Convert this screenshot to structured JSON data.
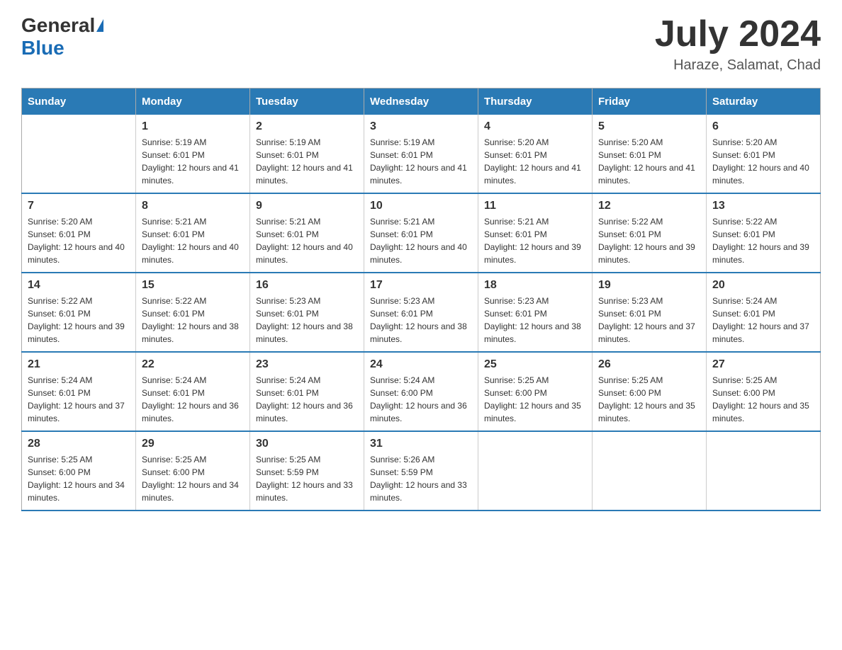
{
  "header": {
    "logo_general": "General",
    "logo_blue": "Blue",
    "month_year": "July 2024",
    "location": "Haraze, Salamat, Chad"
  },
  "days_of_week": [
    "Sunday",
    "Monday",
    "Tuesday",
    "Wednesday",
    "Thursday",
    "Friday",
    "Saturday"
  ],
  "weeks": [
    [
      {
        "day": "",
        "sunrise": "",
        "sunset": "",
        "daylight": ""
      },
      {
        "day": "1",
        "sunrise": "Sunrise: 5:19 AM",
        "sunset": "Sunset: 6:01 PM",
        "daylight": "Daylight: 12 hours and 41 minutes."
      },
      {
        "day": "2",
        "sunrise": "Sunrise: 5:19 AM",
        "sunset": "Sunset: 6:01 PM",
        "daylight": "Daylight: 12 hours and 41 minutes."
      },
      {
        "day": "3",
        "sunrise": "Sunrise: 5:19 AM",
        "sunset": "Sunset: 6:01 PM",
        "daylight": "Daylight: 12 hours and 41 minutes."
      },
      {
        "day": "4",
        "sunrise": "Sunrise: 5:20 AM",
        "sunset": "Sunset: 6:01 PM",
        "daylight": "Daylight: 12 hours and 41 minutes."
      },
      {
        "day": "5",
        "sunrise": "Sunrise: 5:20 AM",
        "sunset": "Sunset: 6:01 PM",
        "daylight": "Daylight: 12 hours and 41 minutes."
      },
      {
        "day": "6",
        "sunrise": "Sunrise: 5:20 AM",
        "sunset": "Sunset: 6:01 PM",
        "daylight": "Daylight: 12 hours and 40 minutes."
      }
    ],
    [
      {
        "day": "7",
        "sunrise": "Sunrise: 5:20 AM",
        "sunset": "Sunset: 6:01 PM",
        "daylight": "Daylight: 12 hours and 40 minutes."
      },
      {
        "day": "8",
        "sunrise": "Sunrise: 5:21 AM",
        "sunset": "Sunset: 6:01 PM",
        "daylight": "Daylight: 12 hours and 40 minutes."
      },
      {
        "day": "9",
        "sunrise": "Sunrise: 5:21 AM",
        "sunset": "Sunset: 6:01 PM",
        "daylight": "Daylight: 12 hours and 40 minutes."
      },
      {
        "day": "10",
        "sunrise": "Sunrise: 5:21 AM",
        "sunset": "Sunset: 6:01 PM",
        "daylight": "Daylight: 12 hours and 40 minutes."
      },
      {
        "day": "11",
        "sunrise": "Sunrise: 5:21 AM",
        "sunset": "Sunset: 6:01 PM",
        "daylight": "Daylight: 12 hours and 39 minutes."
      },
      {
        "day": "12",
        "sunrise": "Sunrise: 5:22 AM",
        "sunset": "Sunset: 6:01 PM",
        "daylight": "Daylight: 12 hours and 39 minutes."
      },
      {
        "day": "13",
        "sunrise": "Sunrise: 5:22 AM",
        "sunset": "Sunset: 6:01 PM",
        "daylight": "Daylight: 12 hours and 39 minutes."
      }
    ],
    [
      {
        "day": "14",
        "sunrise": "Sunrise: 5:22 AM",
        "sunset": "Sunset: 6:01 PM",
        "daylight": "Daylight: 12 hours and 39 minutes."
      },
      {
        "day": "15",
        "sunrise": "Sunrise: 5:22 AM",
        "sunset": "Sunset: 6:01 PM",
        "daylight": "Daylight: 12 hours and 38 minutes."
      },
      {
        "day": "16",
        "sunrise": "Sunrise: 5:23 AM",
        "sunset": "Sunset: 6:01 PM",
        "daylight": "Daylight: 12 hours and 38 minutes."
      },
      {
        "day": "17",
        "sunrise": "Sunrise: 5:23 AM",
        "sunset": "Sunset: 6:01 PM",
        "daylight": "Daylight: 12 hours and 38 minutes."
      },
      {
        "day": "18",
        "sunrise": "Sunrise: 5:23 AM",
        "sunset": "Sunset: 6:01 PM",
        "daylight": "Daylight: 12 hours and 38 minutes."
      },
      {
        "day": "19",
        "sunrise": "Sunrise: 5:23 AM",
        "sunset": "Sunset: 6:01 PM",
        "daylight": "Daylight: 12 hours and 37 minutes."
      },
      {
        "day": "20",
        "sunrise": "Sunrise: 5:24 AM",
        "sunset": "Sunset: 6:01 PM",
        "daylight": "Daylight: 12 hours and 37 minutes."
      }
    ],
    [
      {
        "day": "21",
        "sunrise": "Sunrise: 5:24 AM",
        "sunset": "Sunset: 6:01 PM",
        "daylight": "Daylight: 12 hours and 37 minutes."
      },
      {
        "day": "22",
        "sunrise": "Sunrise: 5:24 AM",
        "sunset": "Sunset: 6:01 PM",
        "daylight": "Daylight: 12 hours and 36 minutes."
      },
      {
        "day": "23",
        "sunrise": "Sunrise: 5:24 AM",
        "sunset": "Sunset: 6:01 PM",
        "daylight": "Daylight: 12 hours and 36 minutes."
      },
      {
        "day": "24",
        "sunrise": "Sunrise: 5:24 AM",
        "sunset": "Sunset: 6:00 PM",
        "daylight": "Daylight: 12 hours and 36 minutes."
      },
      {
        "day": "25",
        "sunrise": "Sunrise: 5:25 AM",
        "sunset": "Sunset: 6:00 PM",
        "daylight": "Daylight: 12 hours and 35 minutes."
      },
      {
        "day": "26",
        "sunrise": "Sunrise: 5:25 AM",
        "sunset": "Sunset: 6:00 PM",
        "daylight": "Daylight: 12 hours and 35 minutes."
      },
      {
        "day": "27",
        "sunrise": "Sunrise: 5:25 AM",
        "sunset": "Sunset: 6:00 PM",
        "daylight": "Daylight: 12 hours and 35 minutes."
      }
    ],
    [
      {
        "day": "28",
        "sunrise": "Sunrise: 5:25 AM",
        "sunset": "Sunset: 6:00 PM",
        "daylight": "Daylight: 12 hours and 34 minutes."
      },
      {
        "day": "29",
        "sunrise": "Sunrise: 5:25 AM",
        "sunset": "Sunset: 6:00 PM",
        "daylight": "Daylight: 12 hours and 34 minutes."
      },
      {
        "day": "30",
        "sunrise": "Sunrise: 5:25 AM",
        "sunset": "Sunset: 5:59 PM",
        "daylight": "Daylight: 12 hours and 33 minutes."
      },
      {
        "day": "31",
        "sunrise": "Sunrise: 5:26 AM",
        "sunset": "Sunset: 5:59 PM",
        "daylight": "Daylight: 12 hours and 33 minutes."
      },
      {
        "day": "",
        "sunrise": "",
        "sunset": "",
        "daylight": ""
      },
      {
        "day": "",
        "sunrise": "",
        "sunset": "",
        "daylight": ""
      },
      {
        "day": "",
        "sunrise": "",
        "sunset": "",
        "daylight": ""
      }
    ]
  ]
}
